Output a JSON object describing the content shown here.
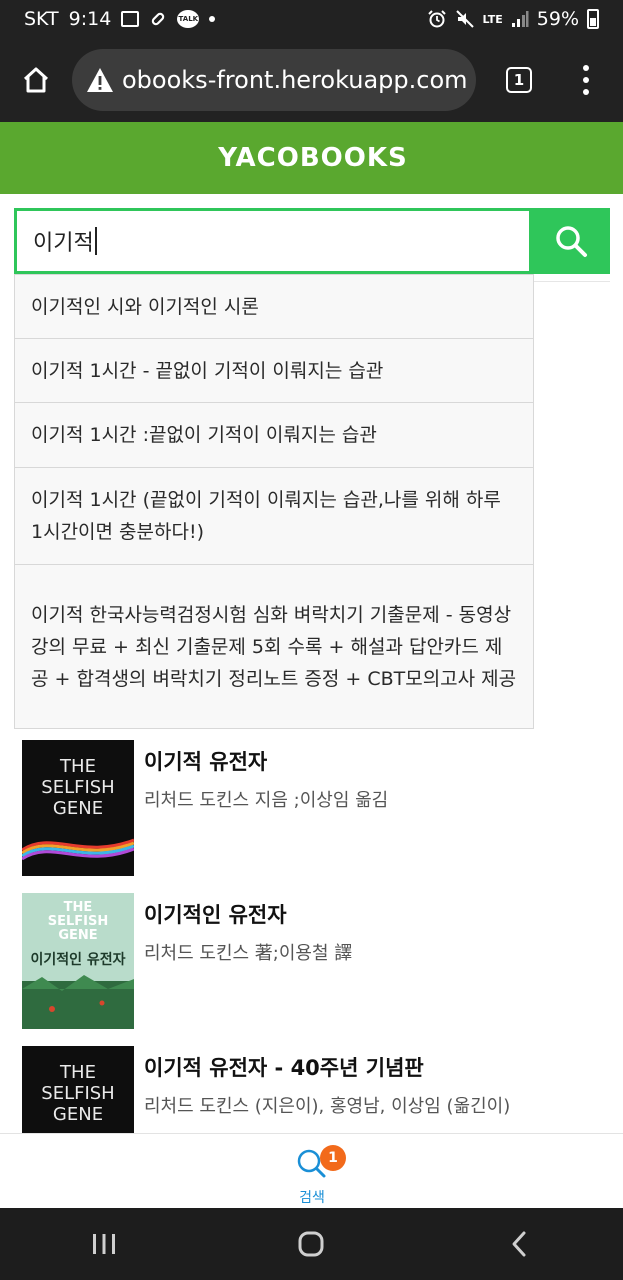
{
  "status_bar": {
    "carrier": "SKT",
    "time": "9:14",
    "talk_label": "TALK",
    "network": "LTE",
    "battery": "59%"
  },
  "browser": {
    "url": "obooks-front.herokuapp.com",
    "tab_count": "1"
  },
  "site": {
    "logo": "YACOBOOKS"
  },
  "search": {
    "query": "이기적"
  },
  "suggestions": [
    "이기적인 시와 이기적인 시론",
    "이기적 1시간 - 끝없이 기적이 이뤄지는 습관",
    "이기적 1시간 :끝없이 기적이 이뤄지는 습관",
    "이기적 1시간 (끝없이 기적이 이뤄지는 습관,나를 위해 하루 1시간이면 충분하다!)",
    "이기적 한국사능력검정시험 심화 벼락치기 기출문제 - 동영상 강의 무료 + 최신 기출문제 5회 수록 + 해설과 답안카드 제공 + 합격생의 벼락치기 정리노트 증정 + CBT모의고사 제공"
  ],
  "books": [
    {
      "title": "이기적 유전자",
      "author": "리처드 도킨스 지음 ;이상임 옮김",
      "cover": [
        "THE",
        "SELFISH",
        "GENE"
      ]
    },
    {
      "title": "이기적인 유전자",
      "author": "리처드 도킨스 著;이용철 譯",
      "cover": [
        "THE",
        "SELFISH",
        "GENE",
        "이기적인 유전자"
      ]
    },
    {
      "title": "이기적 유전자 - 40주년 기념판",
      "author": "리처드 도킨스 (지은이), 홍영남, 이상임 (옮긴이)",
      "cover": [
        "THE",
        "SELFISH",
        "GENE"
      ]
    }
  ],
  "bottom_tab": {
    "label": "검색",
    "badge": "1"
  },
  "colors": {
    "brand_green": "#5aa82f",
    "search_green": "#2fc65a",
    "badge_orange": "#f26a1b",
    "tab_blue": "#1a8fd6"
  }
}
